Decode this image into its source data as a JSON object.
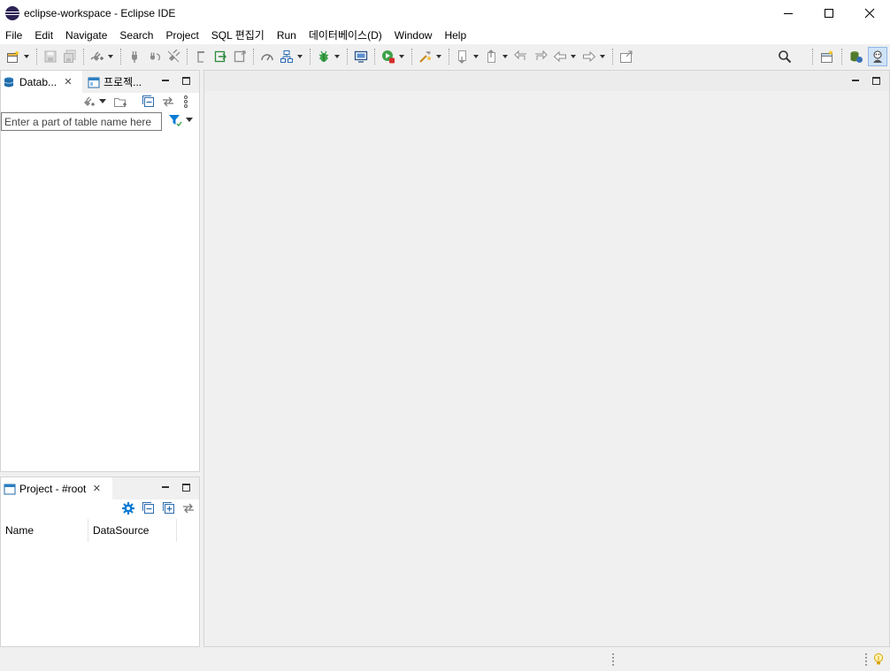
{
  "window": {
    "title": "eclipse-workspace - Eclipse IDE",
    "controls": [
      "minimize",
      "maximize",
      "close"
    ]
  },
  "menubar": {
    "items": [
      "File",
      "Edit",
      "Navigate",
      "Search",
      "Project",
      "SQL 편집기",
      "Run",
      "데이터베이스(D)",
      "Window",
      "Help"
    ]
  },
  "toolbar": {
    "icons": [
      "new-wizard-icon",
      "save-icon",
      "save-all-icon",
      "new-connection-icon",
      "connect-icon",
      "disconnect-icon",
      "invalidate-icon",
      "commit-icon",
      "transaction-icon",
      "open-editor-icon",
      "dashboard-icon",
      "external-tools-icon",
      "debug-icon",
      "terminal-icon",
      "run-icon",
      "tools-icon",
      "next-annotation-icon",
      "prev-annotation-icon",
      "last-edit-icon",
      "back-icon",
      "forward-icon",
      "pin-editor-icon"
    ],
    "search_icon": "search-icon",
    "perspectives": [
      "open-perspective-icon",
      "database-perspective-icon",
      "java-perspective-icon"
    ]
  },
  "database_navigator": {
    "tabs": [
      {
        "label": "Datab...",
        "icon": "database-navigator-icon",
        "closable": true
      },
      {
        "label": "프로젝...",
        "icon": "projects-icon",
        "closable": false
      }
    ],
    "filter_placeholder": "Enter a part of table name here"
  },
  "project_view": {
    "tab_label": "Project - #root",
    "columns": [
      "Name",
      "DataSource"
    ]
  },
  "colors": {
    "accent": "#0a7bd4",
    "panel_border": "#d4d4d4",
    "background": "#f0f0f0"
  }
}
